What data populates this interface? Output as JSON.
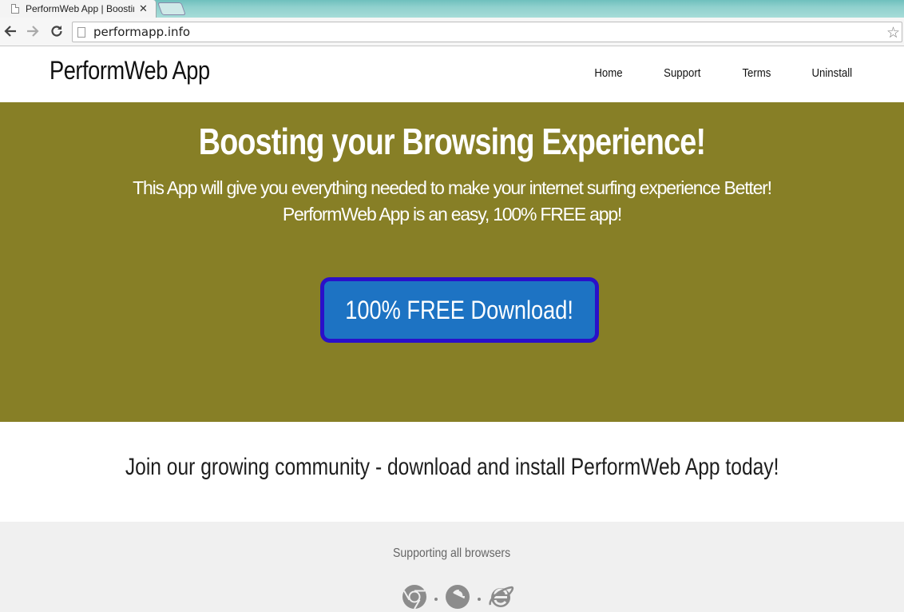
{
  "browser": {
    "tab_title": "PerformWeb App | Boostin",
    "tab_close": "✕",
    "url": "performapp.info"
  },
  "header": {
    "logo": "PerformWeb App",
    "nav": [
      "Home",
      "Support",
      "Terms",
      "Uninstall"
    ]
  },
  "hero": {
    "title": "Boosting your Browsing Experience!",
    "line1": "This App will give you everything needed to make your internet surfing experience Better!",
    "line2": "PerformWeb App is an easy, 100% FREE app!",
    "button": "100% FREE Download!"
  },
  "community": {
    "text": "Join our growing community - download and install PerformWeb App today!"
  },
  "footer": {
    "title": "Supporting all browsers",
    "icons": [
      "chrome-icon",
      "firefox-icon",
      "internet-explorer-icon"
    ]
  },
  "colors": {
    "hero_bg": "#877f26",
    "button_bg": "#1d73c3",
    "button_border": "#2a10c9",
    "footer_bg": "#f0f0f0"
  }
}
